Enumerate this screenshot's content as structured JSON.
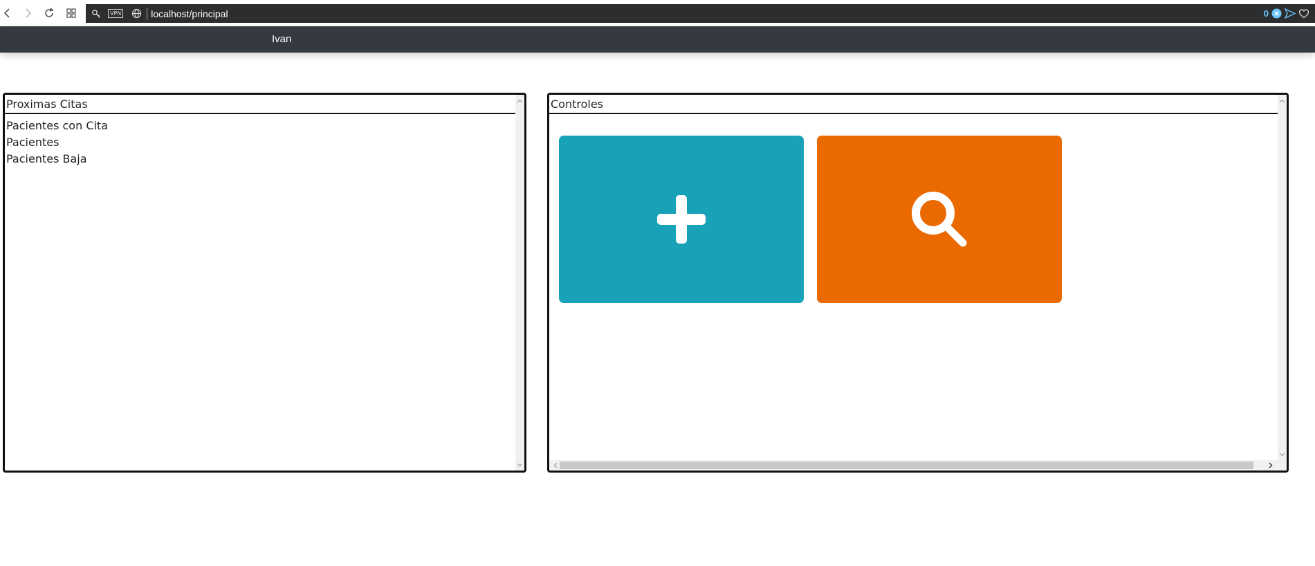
{
  "browser": {
    "url": "localhost/principal",
    "vpn_label": "VPN",
    "blocked_count": "0"
  },
  "navbar": {
    "user": "Ivan"
  },
  "left_panel": {
    "title": "Proximas Citas",
    "items": [
      "Pacientes con Cita",
      "Pacientes",
      "Pacientes Baja"
    ]
  },
  "right_panel": {
    "title": "Controles",
    "tiles": [
      {
        "icon": "plus-icon",
        "color": "#17a2b8"
      },
      {
        "icon": "search-icon",
        "color": "#ea6a00"
      }
    ]
  },
  "colors": {
    "navbar": "#343a40",
    "url_bar": "#2b2d2e",
    "add_tile": "#17a2b8",
    "search_tile": "#ea6a00"
  }
}
